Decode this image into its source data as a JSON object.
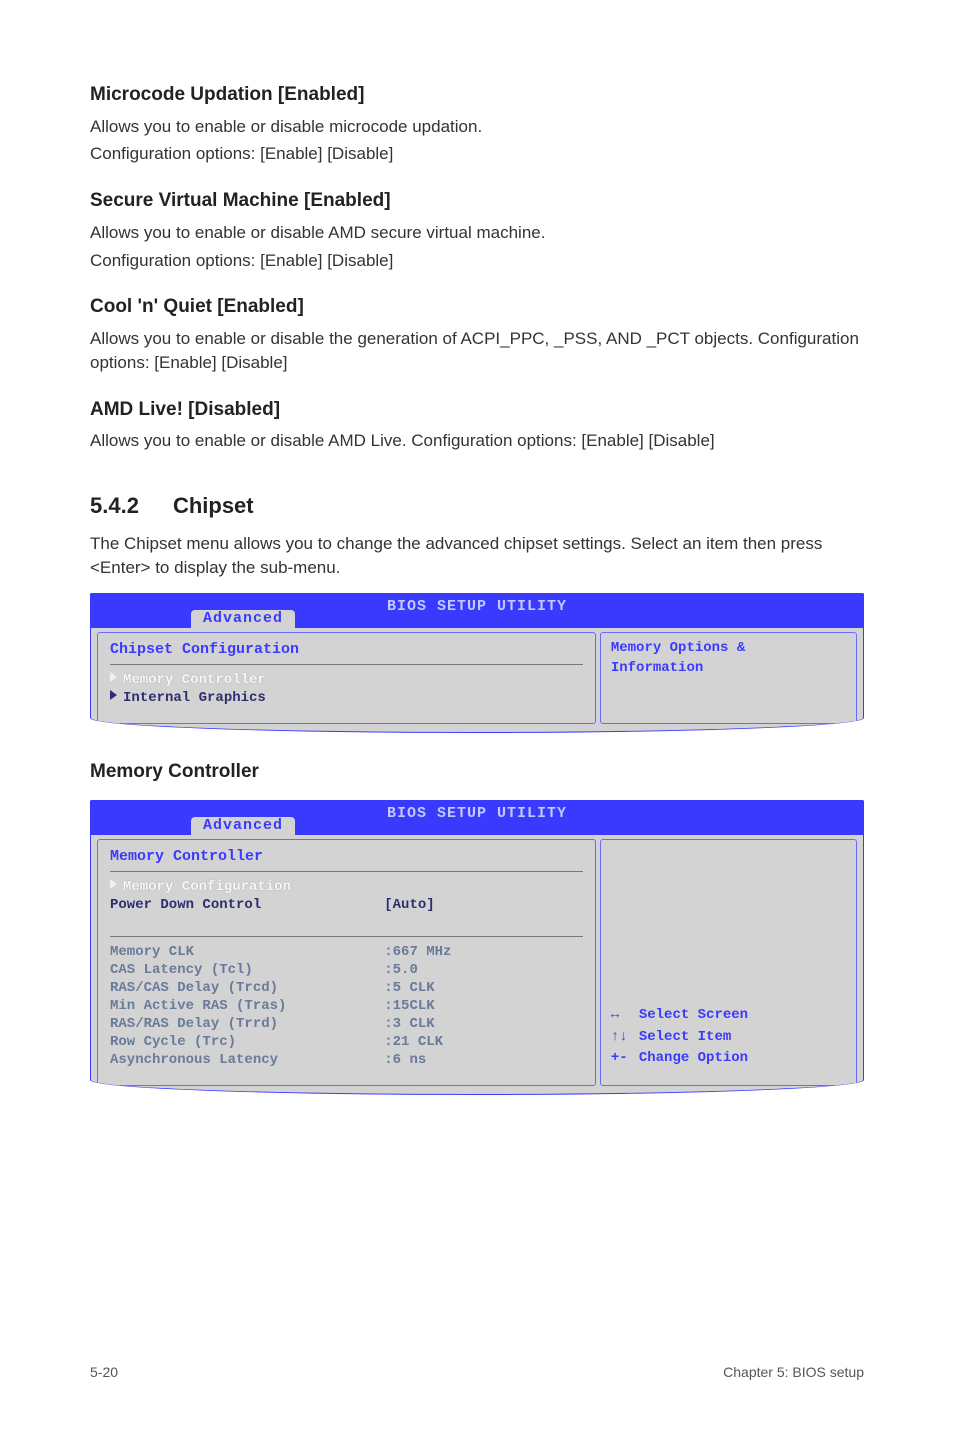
{
  "s1": {
    "title": "Microcode Updation [Enabled]",
    "p1": "Allows you to enable or disable microcode updation.",
    "p2": "Configuration options: [Enable] [Disable]"
  },
  "s2": {
    "title": "Secure Virtual Machine [Enabled]",
    "p1": "Allows you to enable or disable AMD secure virtual machine.",
    "p2": "Configuration options: [Enable] [Disable]"
  },
  "s3": {
    "title": "Cool 'n' Quiet [Enabled]",
    "p1": "Allows you to enable or disable the generation of ACPI_PPC, _PSS, AND _PCT objects. Configuration options: [Enable] [Disable]"
  },
  "s4": {
    "title": "AMD Live! [Disabled]",
    "p1": "Allows you to enable or disable AMD Live. Configuration options: [Enable] [Disable]"
  },
  "chipset": {
    "num": "5.4.2",
    "title": "Chipset",
    "intro": "The Chipset menu allows you to change the advanced chipset settings. Select an item then press <Enter> to display the sub-menu."
  },
  "bios1": {
    "header": "BIOS SETUP UTILITY",
    "tab": "Advanced",
    "left_title": "Chipset Configuration",
    "items": [
      "Memory Controller",
      "Internal Graphics"
    ],
    "right": "Memory Options & Information"
  },
  "memctl_heading": "Memory Controller",
  "bios2": {
    "header": "BIOS SETUP UTILITY",
    "tab": "Advanced",
    "left_title": "Memory Controller",
    "config_row_label": "Memory Configuration",
    "power_label": "Power Down Control",
    "power_value": "[Auto]",
    "rows": [
      {
        "lbl": "Memory CLK",
        "val": ":667 MHz"
      },
      {
        "lbl": "CAS Latency (Tcl)",
        "val": ":5.0"
      },
      {
        "lbl": "RAS/CAS Delay (Trcd)",
        "val": ":5 CLK"
      },
      {
        "lbl": "Min Active RAS (Tras)",
        "val": ":15CLK"
      },
      {
        "lbl": "RAS/RAS Delay (Trrd)",
        "val": ":3 CLK"
      },
      {
        "lbl": "Row Cycle (Trc)",
        "val": ":21 CLK"
      },
      {
        "lbl": "Asynchronous Latency",
        "val": ":6 ns"
      }
    ],
    "legend": [
      {
        "sym": "↔",
        "txt": "Select Screen"
      },
      {
        "sym": "↑↓",
        "txt": "Select Item"
      },
      {
        "sym": "+-",
        "txt": "Change Option"
      }
    ]
  },
  "footer": {
    "left": "5-20",
    "right": "Chapter 5: BIOS setup"
  }
}
